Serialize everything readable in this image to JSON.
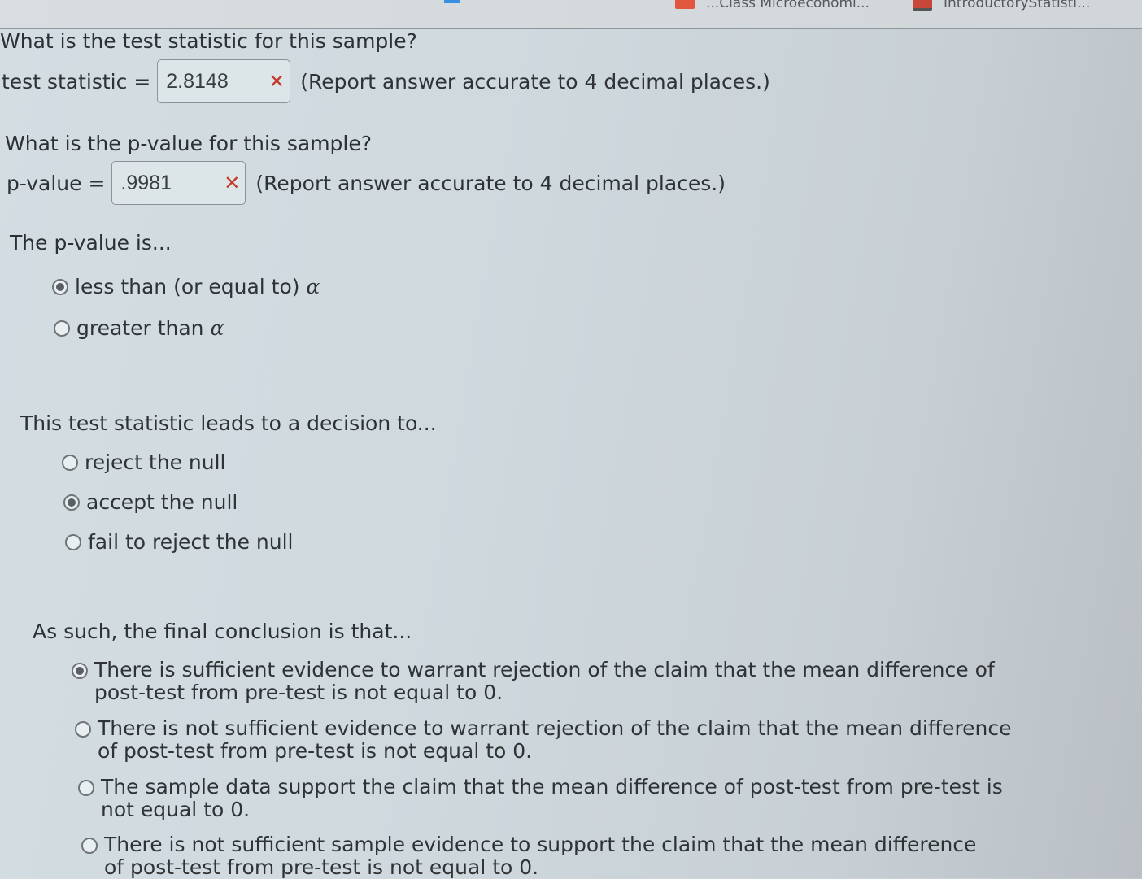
{
  "bookmarks": [
    {
      "icon": "pdf-icon",
      "label": "...Class Microeconomi..."
    },
    {
      "icon": "pdf-icon",
      "label": "IntroductoryStatisti..."
    }
  ],
  "test_statistic": {
    "question": "What is the test statistic for this sample?",
    "label": "test statistic =",
    "value": "2.8148",
    "status_icon": "x-icon",
    "status": "incorrect",
    "hint": "(Report answer accurate to 4 decimal places.)"
  },
  "p_value": {
    "question": "What is the p-value for this sample?",
    "label": "p-value =",
    "value": ".9981",
    "status_icon": "x-icon",
    "status": "incorrect",
    "hint": "(Report answer accurate to 4 decimal places.)"
  },
  "p_value_comparison": {
    "question": "The p-value is...",
    "alpha_symbol": "α",
    "options": [
      {
        "label": "less than (or equal to)",
        "checked": true
      },
      {
        "label": "greater than",
        "checked": false
      }
    ]
  },
  "decision": {
    "question": "This test statistic leads to a decision to...",
    "options": [
      {
        "label": "reject the null",
        "checked": false
      },
      {
        "label": "accept the null",
        "checked": true
      },
      {
        "label": "fail to reject the null",
        "checked": false
      }
    ]
  },
  "conclusion": {
    "question": "As such, the final conclusion is that...",
    "options": [
      {
        "label": "There is sufficient evidence to warrant rejection of the claim that the mean difference of post-test from pre-test is not equal to 0.",
        "checked": true
      },
      {
        "label": "There is not sufficient evidence to warrant rejection of the claim that the mean difference of post-test from pre-test is not equal to 0.",
        "checked": false
      },
      {
        "label": "The sample data support the claim that the mean difference of post-test from pre-test is not equal to 0.",
        "checked": false
      },
      {
        "label": "There is not sufficient sample evidence to support the claim that the mean difference of post-test from pre-test is not equal to 0.",
        "checked": false
      }
    ]
  }
}
